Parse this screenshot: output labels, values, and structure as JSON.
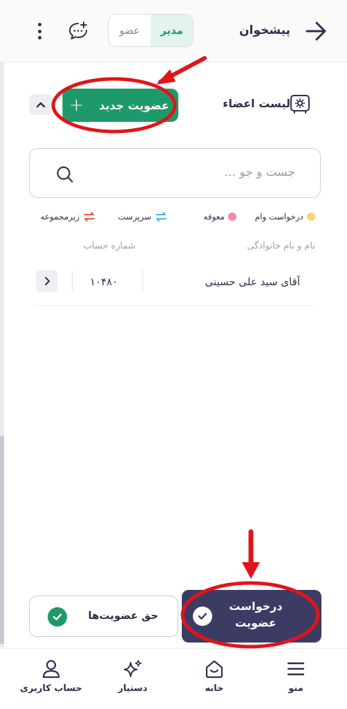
{
  "header": {
    "title": "پیشخوان",
    "role_toggle": {
      "manager": "مدیر",
      "member": "عضو",
      "selected": "manager"
    }
  },
  "section": {
    "title": "لیست اعضاء",
    "new_member_label": "عضویت جدید"
  },
  "search": {
    "placeholder": "جست و جو ..."
  },
  "legend": [
    {
      "label": "درخواست وام",
      "color": "#f7d47a"
    },
    {
      "label": "معوقه",
      "color": "#f28aa8"
    },
    {
      "label": "سرپرست",
      "color": "#3aa8d8"
    },
    {
      "label": "زیرمجموعه",
      "color": "#e0483a"
    }
  ],
  "table": {
    "columns": {
      "name": "نام و نام خانوادگی",
      "account": "شماره حساب"
    },
    "rows": [
      {
        "name": "آقای سید علی حسینی",
        "account": "۱۰۴۸۰"
      }
    ]
  },
  "actions": {
    "membership_fee": "حق عضویت‌ها",
    "membership_request_line1": "درخواست",
    "membership_request_line2": "عضویت"
  },
  "nav": {
    "menu": "منو",
    "home": "خانه",
    "assistant": "دستیار",
    "account": "حساب کاربری"
  },
  "colors": {
    "primary_green": "#1e9a6a",
    "dark_navy": "#3c3b63",
    "annotation_red": "#e1141a"
  }
}
